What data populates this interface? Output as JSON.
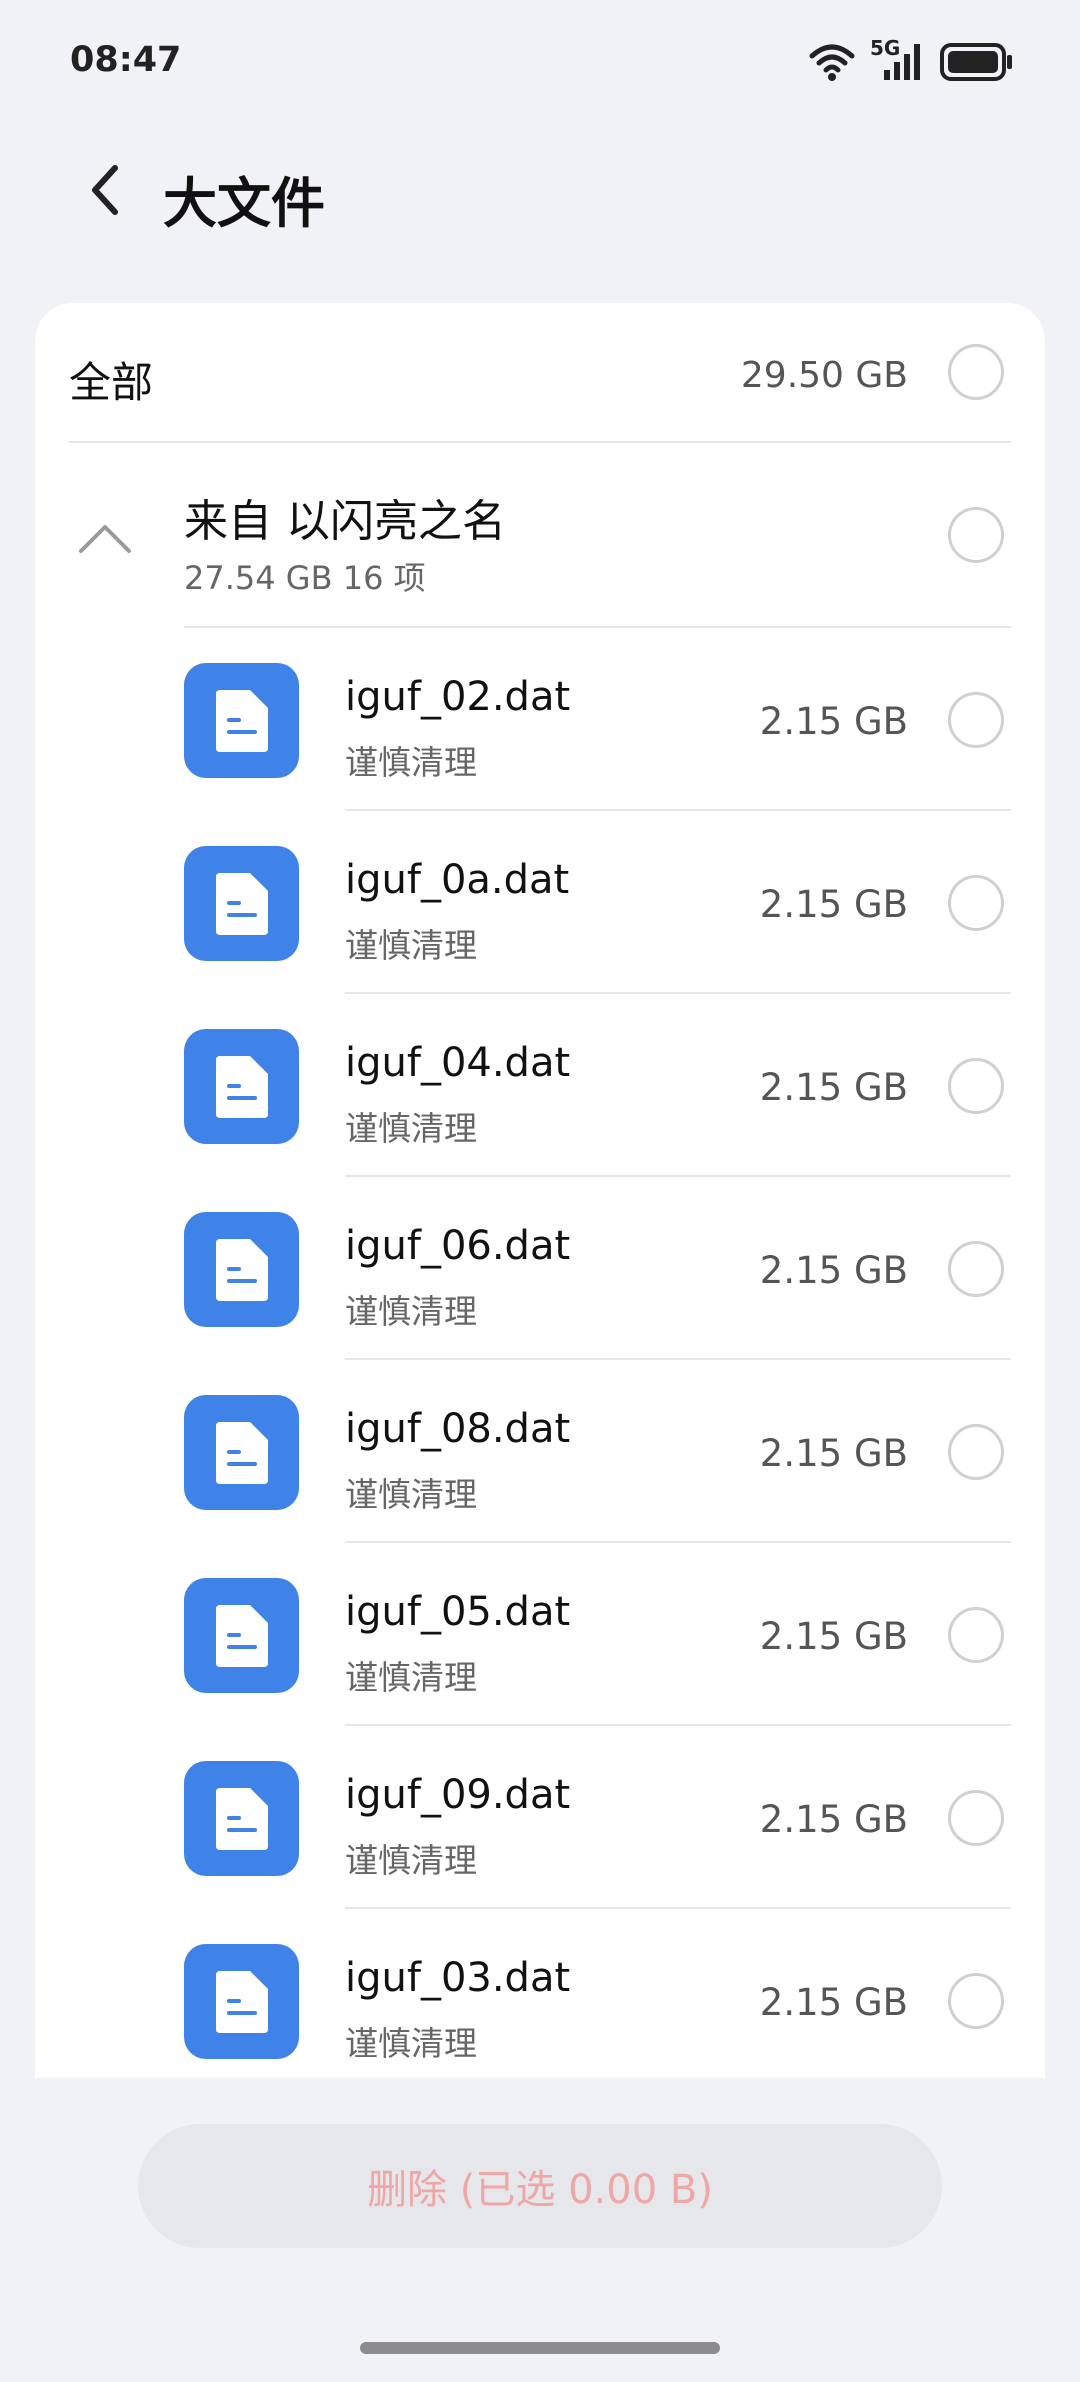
{
  "status_bar": {
    "time": "08:47",
    "network": "5G",
    "icons": [
      "wifi-icon",
      "cellular-signal-icon",
      "battery-icon"
    ]
  },
  "header": {
    "title": "大文件",
    "back_icon": "chevron-left-icon"
  },
  "all_row": {
    "label": "全部",
    "size": "29.50 GB",
    "selected": false
  },
  "group": {
    "title": "来自 以闪亮之名",
    "summary": "27.54 GB 16 项",
    "expanded": true,
    "selected": false
  },
  "files": [
    {
      "name": "iguf_02.dat",
      "note": "谨慎清理",
      "size": "2.15 GB",
      "selected": false
    },
    {
      "name": "iguf_0a.dat",
      "note": "谨慎清理",
      "size": "2.15 GB",
      "selected": false
    },
    {
      "name": "iguf_04.dat",
      "note": "谨慎清理",
      "size": "2.15 GB",
      "selected": false
    },
    {
      "name": "iguf_06.dat",
      "note": "谨慎清理",
      "size": "2.15 GB",
      "selected": false
    },
    {
      "name": "iguf_08.dat",
      "note": "谨慎清理",
      "size": "2.15 GB",
      "selected": false
    },
    {
      "name": "iguf_05.dat",
      "note": "谨慎清理",
      "size": "2.15 GB",
      "selected": false
    },
    {
      "name": "iguf_09.dat",
      "note": "谨慎清理",
      "size": "2.15 GB",
      "selected": false
    },
    {
      "name": "iguf_03.dat",
      "note": "谨慎清理",
      "size": "2.15 GB",
      "selected": false
    }
  ],
  "footer": {
    "delete_label": "删除 (已选 0.00 B)",
    "enabled": false
  },
  "colors": {
    "background": "#f1f2f6",
    "file_icon": "#3f82e8",
    "delete_text": "#efa6a6",
    "delete_bg": "#e6e7eb"
  }
}
